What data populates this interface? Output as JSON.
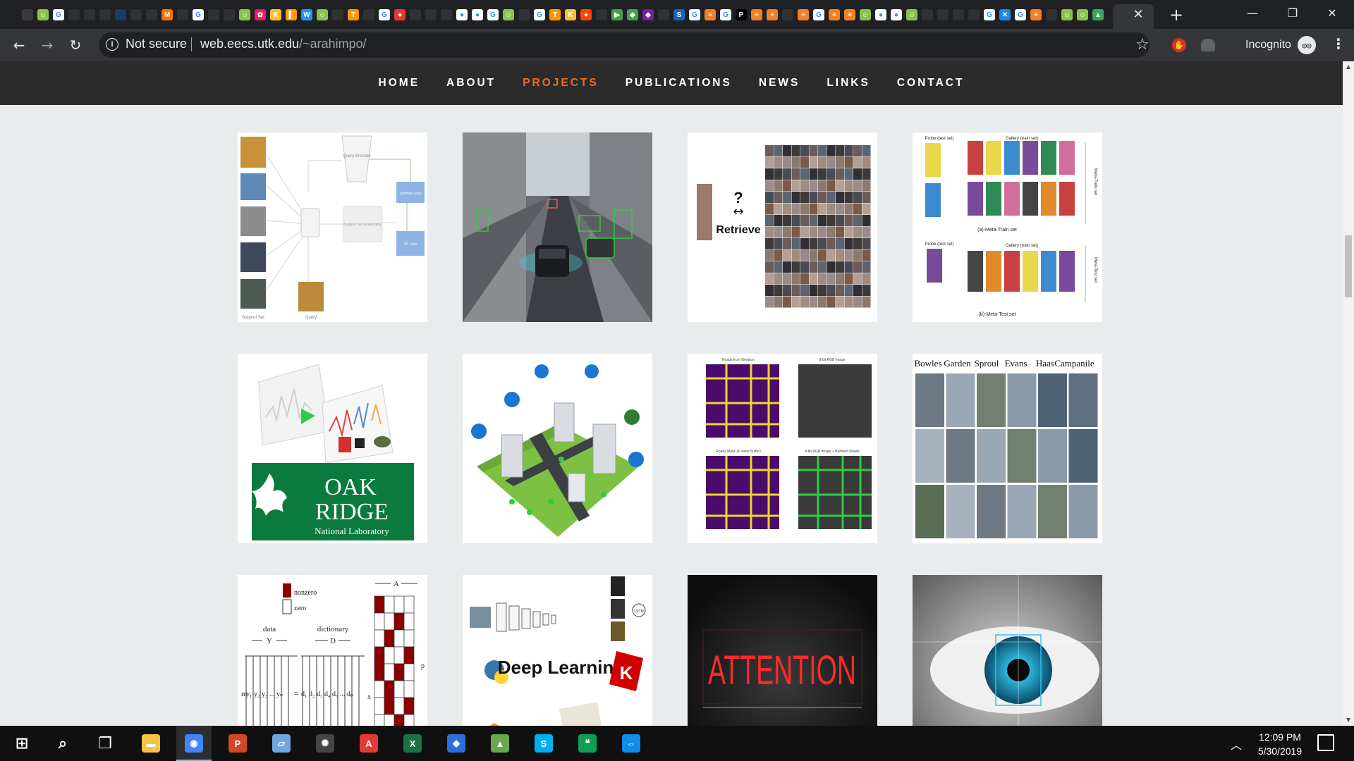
{
  "browser": {
    "tab_favicons": [
      {
        "name": "doc-favicon",
        "color": "#3b3b3b",
        "glyph": ""
      },
      {
        "name": "emoji-favicon",
        "color": "#8bc34a",
        "glyph": "☺"
      },
      {
        "name": "google-favicon",
        "color": "#ffffff",
        "glyph": "G"
      },
      {
        "name": "page-favicon",
        "color": "#303134",
        "glyph": ""
      },
      {
        "name": "page-favicon",
        "color": "#303134",
        "glyph": ""
      },
      {
        "name": "page-favicon",
        "color": "#303134",
        "glyph": ""
      },
      {
        "name": "image-favicon",
        "color": "#1a3a6b",
        "glyph": ""
      },
      {
        "name": "page-favicon",
        "color": "#303134",
        "glyph": ""
      },
      {
        "name": "page-favicon",
        "color": "#303134",
        "glyph": ""
      },
      {
        "name": "jm-favicon",
        "color": "#ff6f00",
        "glyph": "M"
      },
      {
        "name": "page-favicon",
        "color": "#303134",
        "glyph": ""
      },
      {
        "name": "google-favicon",
        "color": "#ffffff",
        "glyph": "G"
      },
      {
        "name": "page-favicon",
        "color": "#303134",
        "glyph": ""
      },
      {
        "name": "page-favicon",
        "color": "#303134",
        "glyph": ""
      },
      {
        "name": "emoji-favicon",
        "color": "#8bc34a",
        "glyph": "☺"
      },
      {
        "name": "flower-favicon",
        "color": "#e91e63",
        "glyph": "✿"
      },
      {
        "name": "k-favicon",
        "color": "#fbc02d",
        "glyph": "K"
      },
      {
        "name": "chart-favicon",
        "color": "#ff9800",
        "glyph": "▌"
      },
      {
        "name": "word-favicon",
        "color": "#2196f3",
        "glyph": "W"
      },
      {
        "name": "emoji-favicon",
        "color": "#8bc34a",
        "glyph": "☺"
      },
      {
        "name": "page-favicon",
        "color": "#303134",
        "glyph": ""
      },
      {
        "name": "tf-favicon",
        "color": "#ff9800",
        "glyph": "T"
      },
      {
        "name": "page-favicon",
        "color": "#303134",
        "glyph": ""
      },
      {
        "name": "google-favicon",
        "color": "#ffffff",
        "glyph": "G"
      },
      {
        "name": "bug-favicon",
        "color": "#e53935",
        "glyph": "●"
      },
      {
        "name": "page-favicon",
        "color": "#303134",
        "glyph": ""
      },
      {
        "name": "page-favicon",
        "color": "#303134",
        "glyph": ""
      },
      {
        "name": "page-favicon",
        "color": "#303134",
        "glyph": ""
      },
      {
        "name": "github-favicon",
        "color": "#ffffff",
        "glyph": "●"
      },
      {
        "name": "github-favicon",
        "color": "#ffffff",
        "glyph": "●"
      },
      {
        "name": "google-favicon",
        "color": "#ffffff",
        "glyph": "G"
      },
      {
        "name": "emoji-favicon",
        "color": "#8bc34a",
        "glyph": "☺"
      },
      {
        "name": "page-favicon",
        "color": "#303134",
        "glyph": ""
      },
      {
        "name": "google-favicon",
        "color": "#ffffff",
        "glyph": "G"
      },
      {
        "name": "tf-favicon",
        "color": "#ff9800",
        "glyph": "T"
      },
      {
        "name": "k-favicon",
        "color": "#fbc02d",
        "glyph": "K"
      },
      {
        "name": "reddit-favicon",
        "color": "#ff4500",
        "glyph": "●"
      },
      {
        "name": "page-favicon",
        "color": "#303134",
        "glyph": ""
      },
      {
        "name": "play-favicon",
        "color": "#43a047",
        "glyph": "▶"
      },
      {
        "name": "shape-favicon",
        "color": "#43a047",
        "glyph": "◆"
      },
      {
        "name": "shape-favicon",
        "color": "#7b1fa2",
        "glyph": "◆"
      },
      {
        "name": "page-favicon",
        "color": "#303134",
        "glyph": ""
      },
      {
        "name": "s-favicon",
        "color": "#1565c0",
        "glyph": "S"
      },
      {
        "name": "google-favicon",
        "color": "#ffffff",
        "glyph": "G"
      },
      {
        "name": "stack-favicon",
        "color": "#f48024",
        "glyph": "≡"
      },
      {
        "name": "google-favicon",
        "color": "#ffffff",
        "glyph": "G"
      },
      {
        "name": "p-favicon",
        "color": "#000000",
        "glyph": "P"
      },
      {
        "name": "stack-favicon",
        "color": "#f48024",
        "glyph": "≡"
      },
      {
        "name": "stack-favicon",
        "color": "#f48024",
        "glyph": "≡"
      },
      {
        "name": "page-favicon",
        "color": "#303134",
        "glyph": ""
      },
      {
        "name": "stack-favicon",
        "color": "#f48024",
        "glyph": "≡"
      },
      {
        "name": "google-favicon",
        "color": "#ffffff",
        "glyph": "G"
      },
      {
        "name": "stack-favicon",
        "color": "#f48024",
        "glyph": "≡"
      },
      {
        "name": "stack-favicon",
        "color": "#f48024",
        "glyph": "≡"
      },
      {
        "name": "emoji-favicon",
        "color": "#8bc34a",
        "glyph": "☺"
      },
      {
        "name": "github-favicon",
        "color": "#ffffff",
        "glyph": "●"
      },
      {
        "name": "github-favicon",
        "color": "#ffffff",
        "glyph": "●"
      },
      {
        "name": "emoji-favicon",
        "color": "#8bc34a",
        "glyph": "☺"
      },
      {
        "name": "page-favicon",
        "color": "#303134",
        "glyph": ""
      },
      {
        "name": "page-favicon",
        "color": "#303134",
        "glyph": ""
      },
      {
        "name": "page-favicon",
        "color": "#303134",
        "glyph": ""
      },
      {
        "name": "page-favicon",
        "color": "#303134",
        "glyph": ""
      },
      {
        "name": "google-favicon",
        "color": "#ffffff",
        "glyph": "G"
      },
      {
        "name": "x-favicon",
        "color": "#1e88e5",
        "glyph": "✕"
      },
      {
        "name": "google-favicon",
        "color": "#ffffff",
        "glyph": "G"
      },
      {
        "name": "stack-favicon",
        "color": "#f48024",
        "glyph": "≡"
      },
      {
        "name": "page-favicon",
        "color": "#303134",
        "glyph": ""
      },
      {
        "name": "emoji-favicon",
        "color": "#8bc34a",
        "glyph": "☺"
      },
      {
        "name": "emoji-favicon",
        "color": "#8bc34a",
        "glyph": "☺"
      },
      {
        "name": "maps-favicon",
        "color": "#34a853",
        "glyph": "▲"
      }
    ],
    "close_tab_glyph": "✕",
    "new_tab_glyph": "+",
    "window_controls": {
      "minimize": "—",
      "restore": "❐",
      "close": "✕"
    },
    "nav": {
      "back": "←",
      "forward": "→",
      "reload": "↻"
    },
    "omnibox": {
      "info_glyph": "i",
      "security_label": "Not secure",
      "host": "web.eecs.utk.edu",
      "path": "/~arahimpo/"
    },
    "bookmark_glyph": "☆",
    "profile_label": "Incognito",
    "menu_glyph": "⋮"
  },
  "site": {
    "nav_items": [
      {
        "label": "HOME",
        "active": false
      },
      {
        "label": "ABOUT",
        "active": false
      },
      {
        "label": "PROJECTS",
        "active": true
      },
      {
        "label": "PUBLICATIONS",
        "active": false
      },
      {
        "label": "NEWS",
        "active": false
      },
      {
        "label": "LINKS",
        "active": false
      },
      {
        "label": "CONTACT",
        "active": false
      }
    ],
    "accent_color": "#f26a23",
    "cards": {
      "few_shot": {
        "query_encoder": "Query Encoder",
        "support_set_embedding": "Support Set Embedding",
        "softmax_loss": "Softmax Loss",
        "ss_loss": "SS Loss",
        "support_set": "Support Set",
        "query": "Query"
      },
      "retrieve": {
        "question": "?",
        "arrow": "↔",
        "label": "Retrieve"
      },
      "meta": {
        "probe_test_set": "Probe (test set)",
        "gallery_train_set": "Gallery (train set)",
        "meta_train_set": "(a)-Meta-Train set",
        "meta_test_set": "(b)-Meta-Test set",
        "side_train": "Meta-Train set",
        "side_test": "Meta-Test set"
      },
      "ornl": {
        "line1": "OAK",
        "line2": "RIDGE",
        "line3": "National Laboratory"
      },
      "roads": {
        "q1": "Roads from Geojson",
        "q2": "8-bit RGB Image",
        "q3": "Roads Mask (4 meter buffer)",
        "q4": "8-bit RGB Image + Buffered Roads"
      },
      "places": {
        "headers": [
          "Bowles",
          "Garden",
          "Sproul",
          "Evans",
          "Haas",
          "Campanile"
        ]
      },
      "dict": {
        "nonzero": "nonzero",
        "zero": "zero",
        "data": "data",
        "dictionary": "dictionary",
        "Y": "Y",
        "D": "D",
        "A": "A",
        "p": "p",
        "m": "m",
        "x": "x",
        "y_terms": "y₁ y₂ y₃ ... yₙ",
        "d_terms": "d₁ d₂ d₃ d₄ d₅ ... dₚ",
        "eq": "="
      },
      "dl": {
        "title": "Deep Learning",
        "k": "K",
        "lstm": "LSTM"
      },
      "attention": {
        "text": "ATTENTION"
      }
    }
  },
  "taskbar": {
    "apps": [
      {
        "name": "start-button",
        "glyph": "⊞",
        "color": "#101010"
      },
      {
        "name": "search-icon",
        "glyph": "⌕",
        "color": "#101010"
      },
      {
        "name": "task-view-icon",
        "glyph": "❐",
        "color": "#101010"
      },
      {
        "name": "file-explorer-icon",
        "glyph": "▬",
        "color": "#f4c542"
      },
      {
        "name": "chrome-icon",
        "glyph": "◉",
        "color": "#4285f4",
        "active": true
      },
      {
        "name": "powerpoint-icon",
        "glyph": "P",
        "color": "#d24726"
      },
      {
        "name": "notes-icon",
        "glyph": "▱",
        "color": "#6fa8dc"
      },
      {
        "name": "settings-app-icon",
        "glyph": "✺",
        "color": "#444444"
      },
      {
        "name": "acrobat-icon",
        "glyph": "A",
        "color": "#e53935"
      },
      {
        "name": "excel-icon",
        "glyph": "X",
        "color": "#1e7145"
      },
      {
        "name": "git-icon",
        "glyph": "◆",
        "color": "#2a6fdb"
      },
      {
        "name": "image-app-icon",
        "glyph": "▲",
        "color": "#6aa84f"
      },
      {
        "name": "skype-icon",
        "glyph": "S",
        "color": "#00aff0"
      },
      {
        "name": "hangouts-icon",
        "glyph": "❝",
        "color": "#0f9d58"
      },
      {
        "name": "teamviewer-icon",
        "glyph": "⇔",
        "color": "#0e8ee9"
      }
    ],
    "tray_chevron": "︿",
    "time": "12:09 PM",
    "date": "5/30/2019"
  }
}
